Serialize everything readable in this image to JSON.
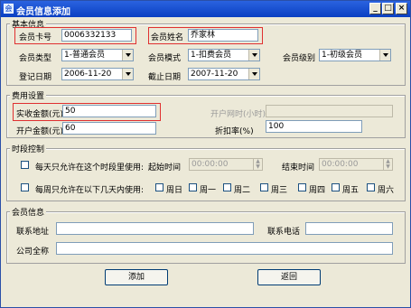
{
  "window": {
    "title": "会员信息添加",
    "app_icon": "会",
    "min": "_",
    "max": "□",
    "close": "×"
  },
  "basic": {
    "legend": "基本信息",
    "card_no_label": "会员卡号",
    "card_no": "0006332133",
    "name_label": "会员姓名",
    "name": "乔家林",
    "type_label": "会员类型",
    "type": "1-普通会员",
    "mode_label": "会员模式",
    "mode": "1-扣费会员",
    "level_label": "会员级别",
    "level": "1-初级会员",
    "reg_date_label": "登记日期",
    "reg_date": "2006-11-20",
    "end_date_label": "截止日期",
    "end_date": "2007-11-20"
  },
  "fee": {
    "legend": "费用设置",
    "received_label": "实收金额(元)",
    "received": "50",
    "open_hours_label": "开户网时(小时)",
    "open_hours": "",
    "open_amount_label": "开户金额(元)",
    "open_amount": "60",
    "discount_label": "折扣率(%)",
    "discount": "100"
  },
  "time": {
    "legend": "时段控制",
    "daily_label": "每天只允许在这个时段里使用:",
    "start_label": "起始时间",
    "start": "00:00:00",
    "end_label": "结束时间",
    "end": "00:00:00",
    "weekly_label": "每周只允许在以下几天内使用:",
    "days": [
      "周日",
      "周一",
      "周二",
      "周三",
      "周四",
      "周五",
      "周六"
    ],
    "spin_up": "▲",
    "spin_down": "▼"
  },
  "member": {
    "legend": "会员信息",
    "address_label": "联系地址",
    "address": "",
    "phone_label": "联系电话",
    "phone": "",
    "company_label": "公司全称",
    "company": ""
  },
  "buttons": {
    "add": "添加",
    "back": "返回"
  }
}
